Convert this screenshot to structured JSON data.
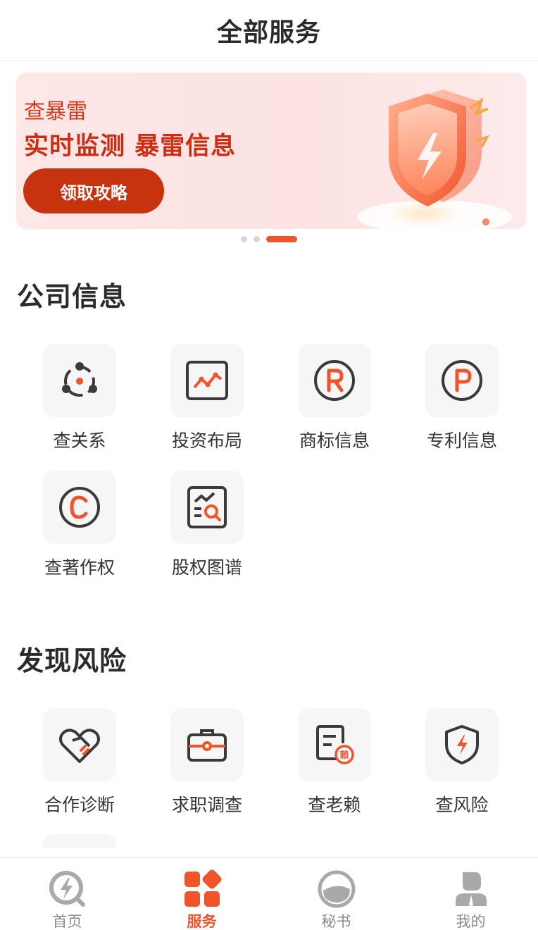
{
  "header": {
    "title": "全部服务"
  },
  "banner": {
    "subtitle": "查暴雷",
    "headline": "实时监测 暴雷信息",
    "button_label": "领取攻略",
    "slide_count": 3,
    "active_slide": 3
  },
  "sections": [
    {
      "title": "公司信息",
      "items": [
        {
          "label": "查关系",
          "icon": "relationship-icon"
        },
        {
          "label": "投资布局",
          "icon": "investment-chart-icon"
        },
        {
          "label": "商标信息",
          "icon": "registered-trademark-icon"
        },
        {
          "label": "专利信息",
          "icon": "patent-icon"
        },
        {
          "label": "查著作权",
          "icon": "copyright-icon"
        },
        {
          "label": "股权图谱",
          "icon": "equity-report-icon"
        }
      ]
    },
    {
      "title": "发现风险",
      "items": [
        {
          "label": "合作诊断",
          "icon": "handshake-heart-icon"
        },
        {
          "label": "求职调查",
          "icon": "briefcase-icon"
        },
        {
          "label": "查老赖",
          "icon": "debtor-document-icon"
        },
        {
          "label": "查风险",
          "icon": "risk-shield-icon"
        }
      ]
    }
  ],
  "tabbar": {
    "items": [
      {
        "label": "首页",
        "icon": "home-bolt-icon",
        "active": false
      },
      {
        "label": "服务",
        "icon": "services-grid-icon",
        "active": true
      },
      {
        "label": "秘书",
        "icon": "secretary-icon",
        "active": false
      },
      {
        "label": "我的",
        "icon": "profile-icon",
        "active": false
      }
    ]
  },
  "colors": {
    "accent": "#f0542b",
    "banner_button": "#c7330f",
    "banner_text": "#cf2d12",
    "icon_dark": "#3a3a3a",
    "tile_bg": "#f6f6f6"
  }
}
